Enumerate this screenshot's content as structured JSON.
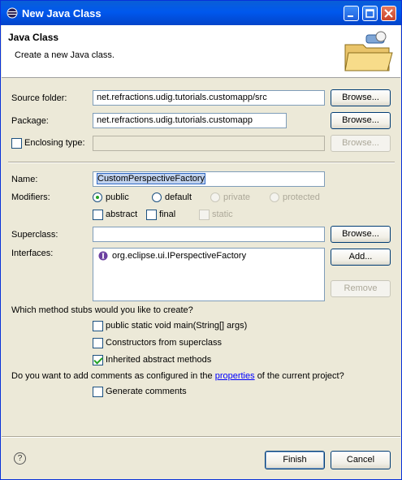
{
  "window": {
    "title": "New Java Class"
  },
  "header": {
    "title": "Java Class",
    "description": "Create a new Java class."
  },
  "fields": {
    "source_folder": {
      "label": "Source folder:",
      "value": "net.refractions.udig.tutorials.customapp/src",
      "browse": "Browse..."
    },
    "package": {
      "label": "Package:",
      "value": "net.refractions.udig.tutorials.customapp",
      "browse": "Browse..."
    },
    "enclosing": {
      "label": "Enclosing type:",
      "value": "",
      "browse": "Browse..."
    },
    "name": {
      "label": "Name:",
      "value": "CustomPerspectiveFactory"
    },
    "modifiers": {
      "label": "Modifiers:",
      "public": "public",
      "default": "default",
      "private": "private",
      "protected": "protected",
      "abstract": "abstract",
      "final": "final",
      "static": "static"
    },
    "superclass": {
      "label": "Superclass:",
      "value": "",
      "browse": "Browse..."
    },
    "interfaces": {
      "label": "Interfaces:",
      "items": [
        "org.eclipse.ui.IPerspectiveFactory"
      ],
      "add": "Add...",
      "remove": "Remove"
    }
  },
  "stubs": {
    "question": "Which method stubs would you like to create?",
    "main": "public static void main(String[] args)",
    "constructors": "Constructors from superclass",
    "inherited": "Inherited abstract methods"
  },
  "comments": {
    "question_pre": "Do you want to add comments as configured in the",
    "link": "properties",
    "question_post": "of the current project?",
    "generate": "Generate comments"
  },
  "footer": {
    "help": "?",
    "finish": "Finish",
    "cancel": "Cancel"
  },
  "colors": {
    "title_bar": "#0058ee",
    "dialog_bg": "#ece9d8",
    "check_green": "#21a121",
    "link": "#0000ff"
  }
}
